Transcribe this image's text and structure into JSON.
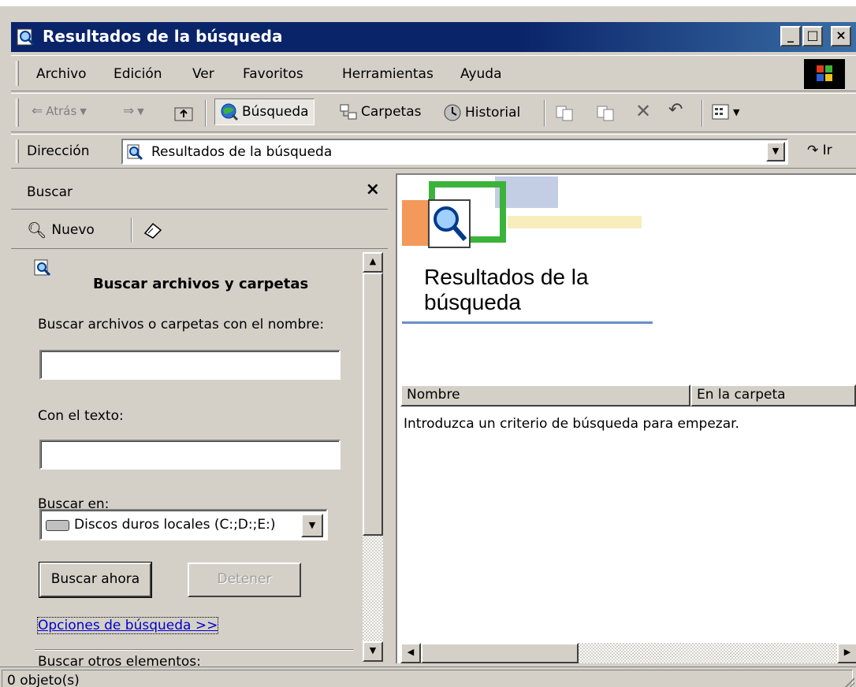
{
  "window": {
    "title": "Resultados de la búsqueda",
    "min_label": "_",
    "max_label": "□",
    "close_label": "×"
  },
  "menubar": {
    "items": [
      "Archivo",
      "Edición",
      "Ver",
      "Favoritos",
      "Herramientas",
      "Ayuda"
    ]
  },
  "toolbar": {
    "back": "Atrás",
    "search": "Búsqueda",
    "folders": "Carpetas",
    "history": "Historial"
  },
  "address": {
    "label": "Dirección",
    "value": "Resultados de la búsqueda",
    "go": "Ir"
  },
  "search_pane": {
    "header": "Buscar",
    "close": "×",
    "new_label": "Nuevo",
    "title": "Buscar archivos y carpetas",
    "name_label": "Buscar archivos o carpetas con el nombre:",
    "name_value": "",
    "text_label": "Con el texto:",
    "text_value": "",
    "look_in_label": "Buscar en:",
    "look_in_value": "Discos duros locales (C:;D:;E:)",
    "search_now": "Buscar ahora",
    "stop": "Detener",
    "options_link": "Opciones de búsqueda >>",
    "other_items": "Buscar otros elementos:"
  },
  "results": {
    "title_line1": "Resultados de la",
    "title_line2": "búsqueda",
    "columns": [
      "Nombre",
      "En la carpeta"
    ],
    "empty_message": "Introduzca un criterio de búsqueda para empezar."
  },
  "status": {
    "text": "0 objeto(s)"
  },
  "colors": {
    "titlebar": "#0a246a",
    "face": "#d4d0c8",
    "link": "#0000cc",
    "accent_rule": "#6a8fc8"
  }
}
